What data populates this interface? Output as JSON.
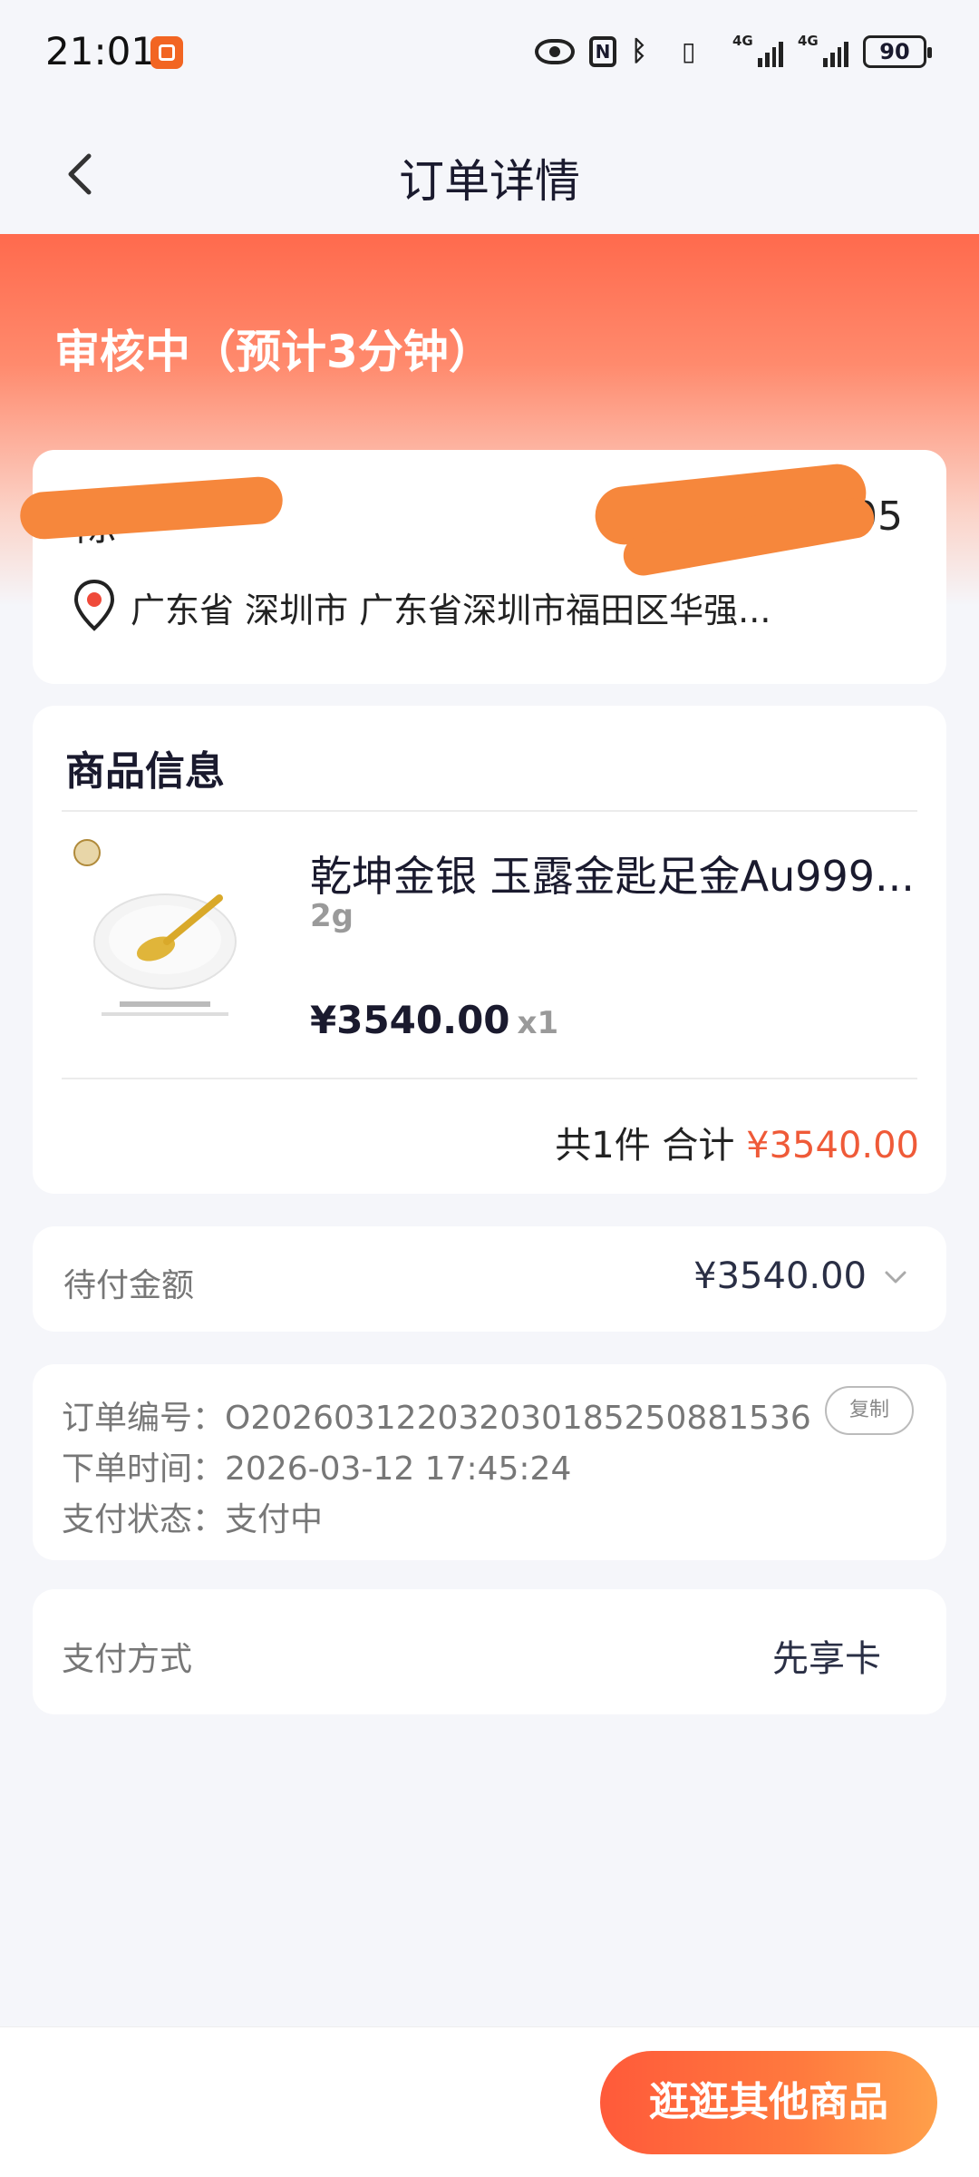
{
  "status_bar": {
    "time": "21:01",
    "network_1": "4G",
    "network_2": "4G",
    "battery": "90"
  },
  "nav": {
    "title": "订单详情"
  },
  "order": {
    "status": "审核中（预计3分钟）"
  },
  "address": {
    "contact_name": "陈**",
    "phone": "17******05",
    "location": "广东省 深圳市   广东省深圳市福田区华强..."
  },
  "product_section": {
    "title": "商品信息",
    "name": "乾坤金银 玉露金匙足金Au999...",
    "spec": "2g",
    "price": "¥3540.00",
    "qty": "x1",
    "summary_count": "共1件 合计 ",
    "summary_total": "¥3540.00"
  },
  "amount": {
    "label": "待付金额",
    "value": "¥3540.00"
  },
  "order_info": {
    "number_label": "订单编号：",
    "number_value": "O202603122032030185250881536",
    "time_label": "下单时间：",
    "time_value": "2026-03-12 17:45:24",
    "pay_status_label": "支付状态：",
    "pay_status_value": "支付中",
    "copy_label": "复制"
  },
  "payment": {
    "label": "支付方式",
    "value": "先享卡"
  },
  "bottom": {
    "cta_label": "逛逛其他商品"
  },
  "colors": {
    "accent": "#ff6a4d",
    "price_red": "#ef5a38",
    "redaction": "#f6873c"
  }
}
